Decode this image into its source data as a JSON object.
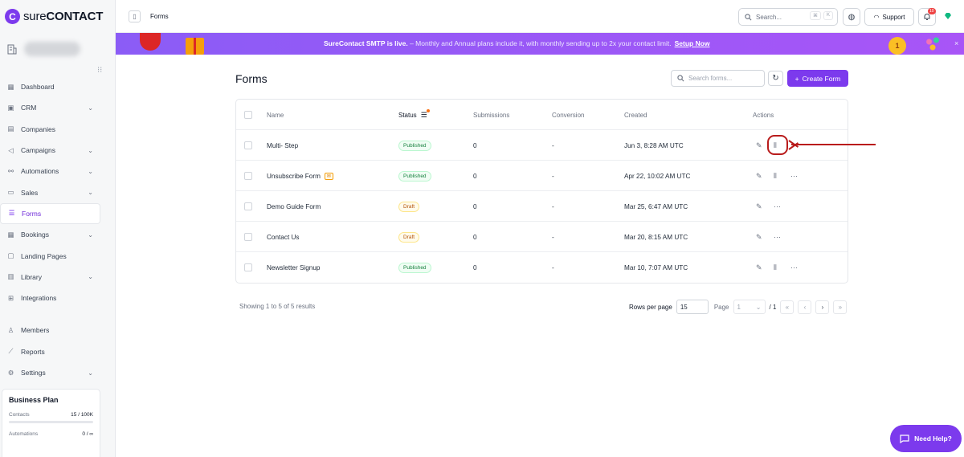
{
  "app": {
    "brand_prefix": "sure",
    "brand_suffix": "CONTACT",
    "logo_letter": "C"
  },
  "sidebar": {
    "collapse_glyph": "⁝⁝",
    "items": [
      {
        "label": "Dashboard",
        "icon": "dashboard-icon",
        "chevron": false
      },
      {
        "label": "CRM",
        "icon": "crm-icon",
        "chevron": true
      },
      {
        "label": "Companies",
        "icon": "companies-icon",
        "chevron": false
      },
      {
        "label": "Campaigns",
        "icon": "campaigns-icon",
        "chevron": true
      },
      {
        "label": "Automations",
        "icon": "automations-icon",
        "chevron": true
      },
      {
        "label": "Sales",
        "icon": "sales-icon",
        "chevron": true
      },
      {
        "label": "Forms",
        "icon": "forms-icon",
        "chevron": false,
        "active": true
      },
      {
        "label": "Bookings",
        "icon": "bookings-icon",
        "chevron": true
      },
      {
        "label": "Landing Pages",
        "icon": "landing-pages-icon",
        "chevron": false
      },
      {
        "label": "Library",
        "icon": "library-icon",
        "chevron": true
      },
      {
        "label": "Integrations",
        "icon": "integrations-icon",
        "chevron": false
      }
    ],
    "bottom_items": [
      {
        "label": "Members",
        "icon": "members-icon",
        "chevron": false
      },
      {
        "label": "Reports",
        "icon": "reports-icon",
        "chevron": false
      },
      {
        "label": "Settings",
        "icon": "settings-icon",
        "chevron": true
      }
    ],
    "plan": {
      "title": "Business Plan",
      "contacts_label": "Contacts",
      "contacts_value": "15 / 100K",
      "automations_label": "Automations",
      "automations_value": "0 / ∞"
    }
  },
  "topbar": {
    "breadcrumb": "Forms",
    "search_placeholder": "Search...",
    "shortcut_key": "K",
    "shortcut_symbol": "⌘",
    "support_label": "Support",
    "notification_count": "10"
  },
  "banner": {
    "headline": "SureContact SMTP is live.",
    "separator": " – ",
    "message": "Monthly and Annual plans include it, with monthly sending up to 2x your contact limit.",
    "cta": "Setup Now",
    "medal_number": "1",
    "close_glyph": "×"
  },
  "main": {
    "title": "Forms",
    "search_placeholder": "Search forms...",
    "create_label": "Create Form",
    "columns": {
      "name": "Name",
      "status": "Status",
      "submissions": "Submissions",
      "conversion": "Conversion",
      "created": "Created",
      "actions": "Actions"
    },
    "rows": [
      {
        "name": "Multi- Step",
        "status": "Published",
        "submissions": "0",
        "conversion": "-",
        "created": "Jun 3, 8:28 AM UTC",
        "has_email_tag": false,
        "has_analytics": true,
        "has_more": false
      },
      {
        "name": "Unsubscribe Form",
        "status": "Published",
        "submissions": "0",
        "conversion": "-",
        "created": "Apr 22, 10:02 AM UTC",
        "has_email_tag": true,
        "has_analytics": true,
        "has_more": true
      },
      {
        "name": "Demo Guide Form",
        "status": "Draft",
        "submissions": "0",
        "conversion": "-",
        "created": "Mar 25, 6:47 AM UTC",
        "has_email_tag": false,
        "has_analytics": false,
        "has_more": true
      },
      {
        "name": "Contact Us",
        "status": "Draft",
        "submissions": "0",
        "conversion": "-",
        "created": "Mar 20, 8:15 AM UTC",
        "has_email_tag": false,
        "has_analytics": false,
        "has_more": true
      },
      {
        "name": "Newsletter Signup",
        "status": "Published",
        "submissions": "0",
        "conversion": "-",
        "created": "Mar 10, 7:07 AM UTC",
        "has_email_tag": false,
        "has_analytics": true,
        "has_more": true
      }
    ],
    "footer": {
      "showing": "Showing 1 to 5 of 5 results",
      "rows_per_page_label": "Rows per page",
      "rows_per_page_value": "15",
      "page_label": "Page",
      "page_value": "1",
      "page_total": "/ 1"
    }
  },
  "help": {
    "label": "Need Help?"
  },
  "colors": {
    "accent": "#7c3aed",
    "highlight": "#b91c1c",
    "published": "#15803d",
    "draft": "#b45309"
  }
}
